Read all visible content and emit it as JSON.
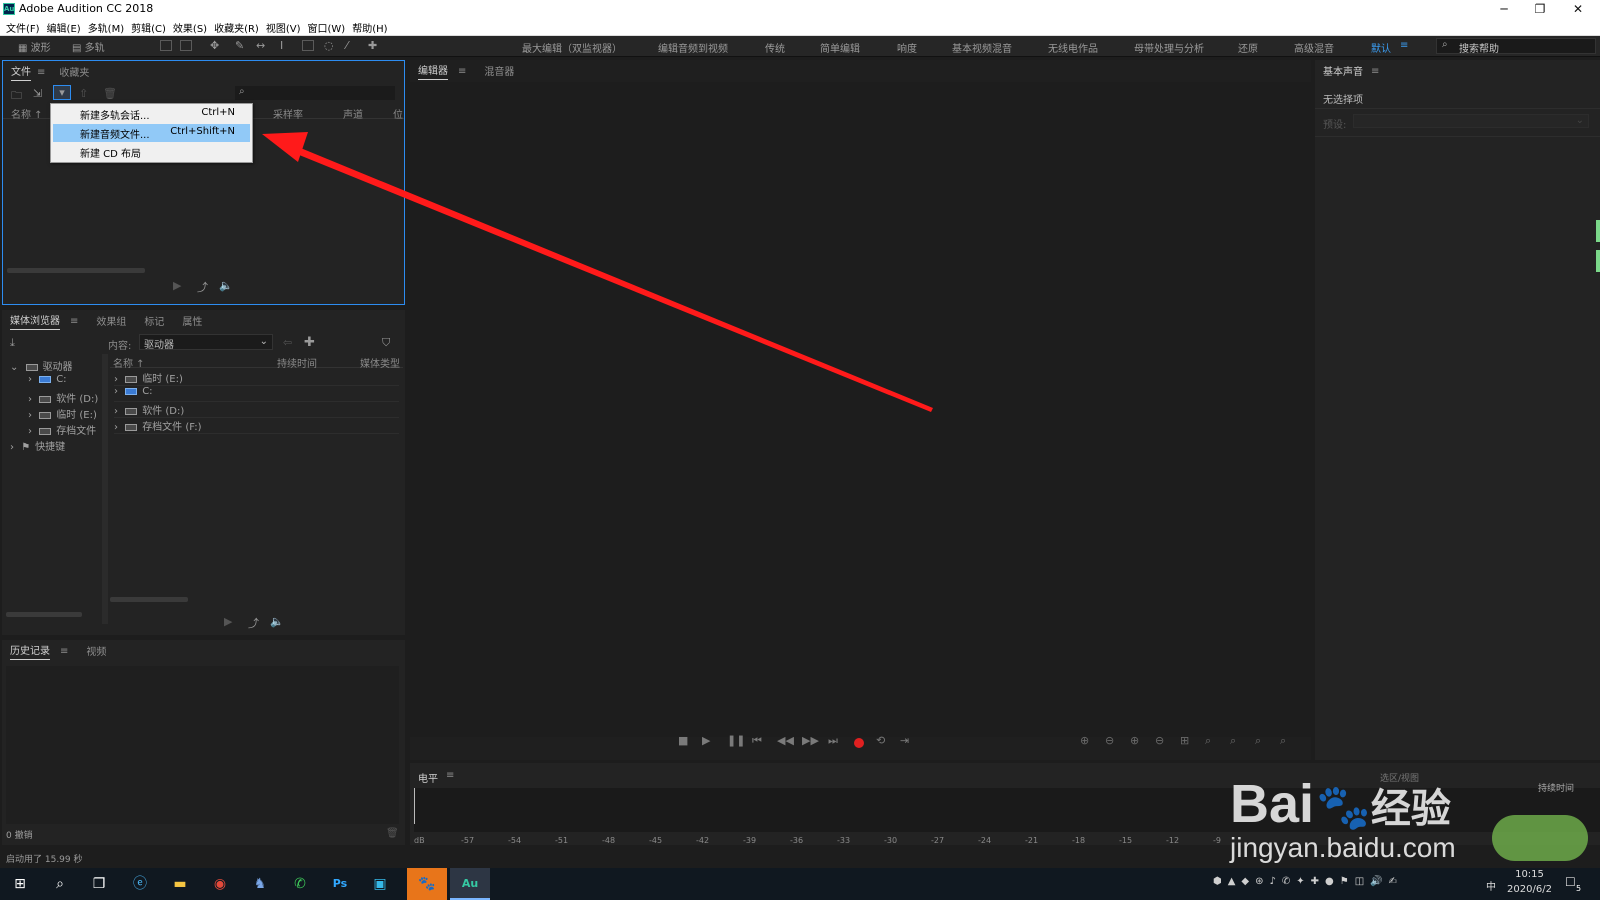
{
  "window": {
    "icon_text": "Au",
    "title": "Adobe Audition CC 2018",
    "controls": {
      "minimize": "─",
      "restore": "❐",
      "close": "✕"
    }
  },
  "menubar": [
    "文件(F)",
    "编辑(E)",
    "多轨(M)",
    "剪辑(C)",
    "效果(S)",
    "收藏夹(R)",
    "视图(V)",
    "窗口(W)",
    "帮助(H)"
  ],
  "toolbar": {
    "waveform_label": "波形",
    "multitrack_label": "多轨",
    "workspaces": [
      "最大编辑（双监视器）",
      "编辑音频到视频",
      "传统",
      "简单编辑",
      "响度",
      "基本视频混音",
      "无线电作品",
      "母带处理与分析",
      "还原",
      "高级混音",
      "默认"
    ],
    "active_workspace": "默认",
    "help_search_placeholder": "搜索帮助"
  },
  "file_panel": {
    "tabs": [
      "文件",
      "收藏夹"
    ],
    "columns": [
      "名称 ↑",
      "采样率",
      "声道",
      "位"
    ],
    "new_menu": [
      {
        "label": "新建多轨会话...",
        "shortcut": "Ctrl+N"
      },
      {
        "label": "新建音频文件...",
        "shortcut": "Ctrl+Shift+N"
      },
      {
        "label": "新建 CD 布局",
        "shortcut": ""
      }
    ],
    "highlighted_item": 1
  },
  "media_panel": {
    "tabs": [
      "媒体浏览器",
      "效果组",
      "标记",
      "属性"
    ],
    "content_label": "内容:",
    "content_value": "驱动器",
    "tree": [
      {
        "label": "驱动器",
        "level": 0,
        "expanded": true
      },
      {
        "label": "C:",
        "level": 1
      },
      {
        "label": "软件 (D:)",
        "level": 1
      },
      {
        "label": "临时 (E:)",
        "level": 1
      },
      {
        "label": "存档文件",
        "level": 1
      },
      {
        "label": "快捷键",
        "level": 0
      }
    ],
    "columns": [
      "名称 ↑",
      "持续时间",
      "媒体类型"
    ],
    "rows": [
      "临时 (E:)",
      "C:",
      "软件 (D:)",
      "存档文件 (F:)"
    ]
  },
  "history_panel": {
    "tabs": [
      "历史记录",
      "视频"
    ],
    "undo_count": "0 撤销"
  },
  "editor_panel": {
    "tabs": [
      "编辑器",
      "混音器"
    ]
  },
  "level_panel": {
    "title": "电平",
    "db_labels": [
      "dB",
      "-57",
      "-54",
      "-51",
      "-48",
      "-45",
      "-42",
      "-39",
      "-36",
      "-33",
      "-30",
      "-27",
      "-24",
      "-21",
      "-18",
      "-15",
      "-12",
      "-9"
    ]
  },
  "essential_panel": {
    "title": "基本声音",
    "no_selection": "无选择项",
    "preset_label": "预设:"
  },
  "status": {
    "startup": "启动用了 15.99 秒"
  },
  "selection_view": {
    "selection_label": "选区/视图",
    "duration_label": "持续时间"
  },
  "taskbar": {
    "ime": "中",
    "time": "10:15",
    "date": "2020/6/2",
    "notification_count": "5"
  },
  "watermark": {
    "brand": "Bai",
    "brand_cn": "经验",
    "url": "jingyan.baidu.com"
  },
  "colors": {
    "accent": "#2d8cf0",
    "arrow": "#ff1a1a",
    "highlight": "#91c9f7",
    "record": "#e02020"
  }
}
